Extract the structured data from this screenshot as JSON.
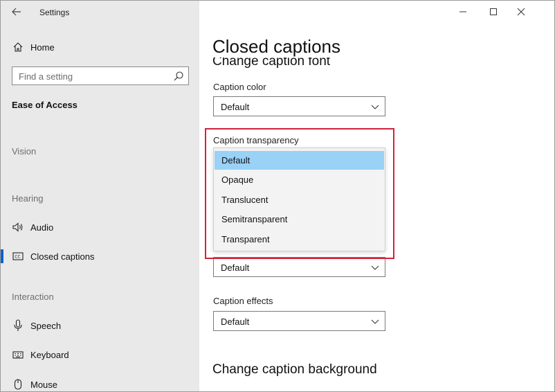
{
  "app_title": "Settings",
  "sidebar": {
    "home": "Home",
    "search_placeholder": "Find a setting",
    "section_title": "Ease of Access",
    "groups": {
      "vision": "Vision",
      "hearing": "Hearing",
      "interaction": "Interaction"
    },
    "items": {
      "audio": "Audio",
      "closed_captions": "Closed captions",
      "speech": "Speech",
      "keyboard": "Keyboard",
      "mouse": "Mouse"
    },
    "accent_color": "#0a64c8"
  },
  "main": {
    "page_title": "Closed captions",
    "cut_heading": "Change caption font",
    "caption_color": {
      "label": "Caption color",
      "value": "Default"
    },
    "caption_transparency": {
      "label": "Caption transparency",
      "options": [
        "Default",
        "Opaque",
        "Translucent",
        "Semitransparent",
        "Transparent"
      ],
      "selected": "Default"
    },
    "hidden_combo_value": "Default",
    "caption_effects": {
      "label": "Caption effects",
      "value": "Default"
    },
    "section_heading": "Change caption background"
  },
  "colors": {
    "highlight_border": "#d0223a",
    "selected_option": "#99d1f7",
    "sidebar_bg": "#e9e9e9"
  }
}
